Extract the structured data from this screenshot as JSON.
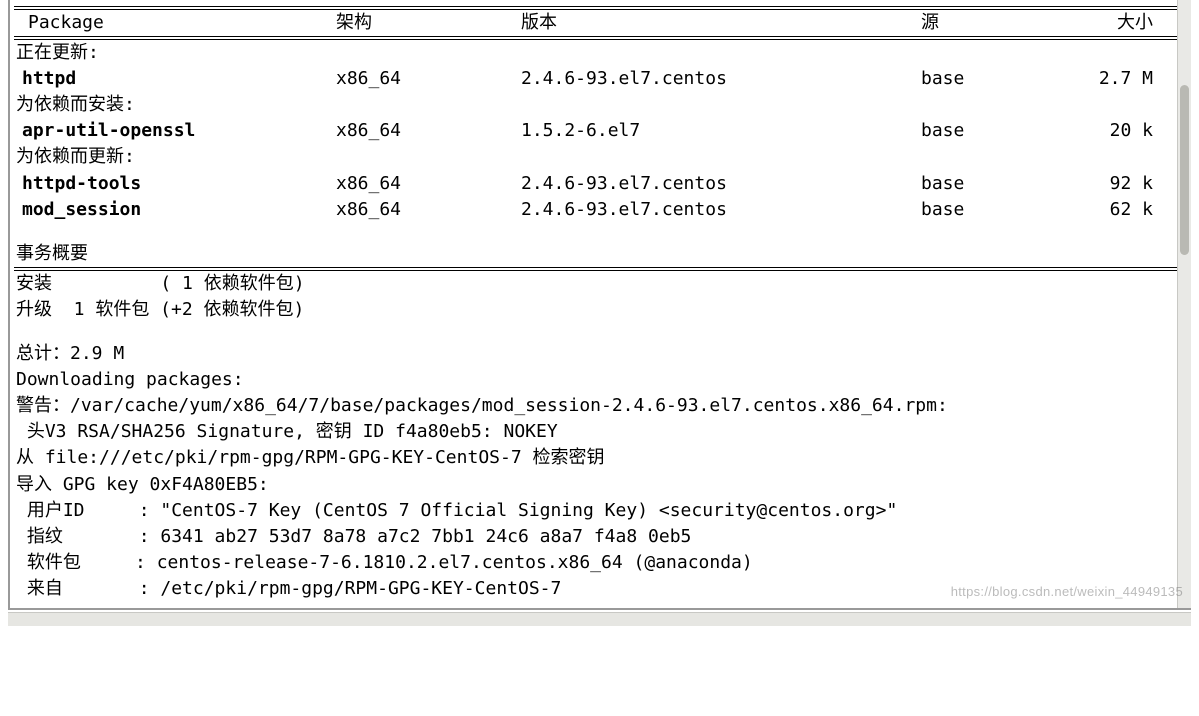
{
  "headers": {
    "package": "Package",
    "arch": "架构",
    "version": "版本",
    "repo": "源",
    "size": "大小"
  },
  "sections": {
    "updating": "正在更新:",
    "install_dep": "为依赖而安装:",
    "update_dep": "为依赖而更新:"
  },
  "packages": {
    "updating": [
      {
        "name": "httpd",
        "arch": "x86_64",
        "version": "2.4.6-93.el7.centos",
        "repo": "base",
        "size": "2.7 M"
      }
    ],
    "install_dep": [
      {
        "name": "apr-util-openssl",
        "arch": "x86_64",
        "version": "1.5.2-6.el7",
        "repo": "base",
        "size": "20 k"
      }
    ],
    "update_dep": [
      {
        "name": "httpd-tools",
        "arch": "x86_64",
        "version": "2.4.6-93.el7.centos",
        "repo": "base",
        "size": "92 k"
      },
      {
        "name": "mod_session",
        "arch": "x86_64",
        "version": "2.4.6-93.el7.centos",
        "repo": "base",
        "size": "62 k"
      }
    ]
  },
  "summary_title": "事务概要",
  "summary": {
    "install_line": "安装          ( 1 依赖软件包)",
    "upgrade_line": "升级  1 软件包 (+2 依赖软件包)"
  },
  "total_line": "总计：2.9 M",
  "downloading_line": "Downloading packages:",
  "warning_line": "警告：/var/cache/yum/x86_64/7/base/packages/mod_session-2.4.6-93.el7.centos.x86_64.rpm:",
  "sig_line": " 头V3 RSA/SHA256 Signature, 密钥 ID f4a80eb5: NOKEY",
  "retrieve_line": "从 file:///etc/pki/rpm-gpg/RPM-GPG-KEY-CentOS-7 检索密钥",
  "import_line": "导入 GPG key 0xF4A80EB5:",
  "gpg": {
    "userid": " 用户ID     : \"CentOS-7 Key (CentOS 7 Official Signing Key) <security@centos.org>\"",
    "finger": " 指纹       : 6341 ab27 53d7 8a78 a7c2 7bb1 24c6 a8a7 f4a8 0eb5",
    "package": " 软件包     : centos-release-7-6.1810.2.el7.centos.x86_64 (@anaconda)",
    "from": " 来自       : /etc/pki/rpm-gpg/RPM-GPG-KEY-CentOS-7"
  },
  "watermark": "https://blog.csdn.net/weixin_44949135"
}
